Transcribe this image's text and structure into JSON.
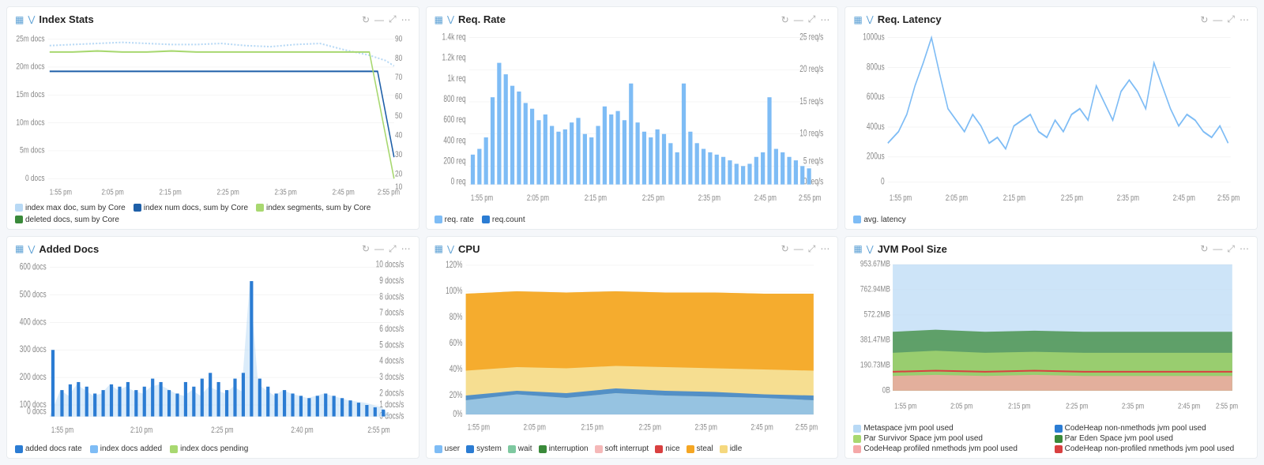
{
  "panels": {
    "index_stats": {
      "title": "Index Stats",
      "legend": [
        {
          "color": "#b8d9f5",
          "label": "index max doc, sum by Core"
        },
        {
          "color": "#1e5fa8",
          "label": "index num docs, sum by Core"
        },
        {
          "color": "#a8d870",
          "label": "index segments, sum by Core"
        },
        {
          "color": "#3a8a3a",
          "label": "deleted docs, sum by Core"
        }
      ],
      "y_labels_left": [
        "25m docs",
        "20m docs",
        "15m docs",
        "10m docs",
        "5m docs",
        "0 docs"
      ],
      "y_labels_right": [
        "90",
        "80",
        "70",
        "60",
        "50",
        "40",
        "30",
        "20",
        "10"
      ],
      "x_labels": [
        "1:55 pm",
        "2:05 pm",
        "2:15 pm",
        "2:25 pm",
        "2:35 pm",
        "2:45 pm",
        "2:55 pm"
      ]
    },
    "req_rate": {
      "title": "Req. Rate",
      "legend": [
        {
          "color": "#7ebcf5",
          "label": "req. rate"
        },
        {
          "color": "#2b7cd3",
          "label": "req.count"
        }
      ],
      "y_labels_left": [
        "1.4k req",
        "1.2k req",
        "1k req",
        "800 req",
        "600 req",
        "400 req",
        "200 req",
        "0 req"
      ],
      "y_labels_right": [
        "25 req/s",
        "20 req/s",
        "15 req/s",
        "10 req/s",
        "5 req/s",
        "0 req/s"
      ],
      "x_labels": [
        "1:55 pm",
        "2:05 pm",
        "2:15 pm",
        "2:25 pm",
        "2:35 pm",
        "2:45 pm",
        "2:55 pm"
      ]
    },
    "req_latency": {
      "title": "Req. Latency",
      "legend": [
        {
          "color": "#7ebcf5",
          "label": "avg. latency"
        }
      ],
      "y_labels_left": [
        "1000us",
        "800us",
        "600us",
        "400us",
        "200us",
        "0"
      ],
      "x_labels": [
        "1:55 pm",
        "2:05 pm",
        "2:15 pm",
        "2:25 pm",
        "2:35 pm",
        "2:45 pm",
        "2:55 pm"
      ]
    },
    "added_docs": {
      "title": "Added Docs",
      "legend": [
        {
          "color": "#2b7cd3",
          "label": "added docs rate"
        },
        {
          "color": "#7ebcf5",
          "label": "index docs added"
        },
        {
          "color": "#a8d870",
          "label": "index docs pending"
        }
      ],
      "y_labels_left": [
        "600 docs",
        "500 docs",
        "400 docs",
        "300 docs",
        "200 docs",
        "100 docs",
        "0 docs"
      ],
      "y_labels_right": [
        "10 docs/s",
        "9 docs/s",
        "8 docs/s",
        "7 docs/s",
        "6 docs/s",
        "5 docs/s",
        "4 docs/s",
        "3 docs/s",
        "2 docs/s",
        "1 docs/s",
        "0 docs/s"
      ],
      "x_labels": [
        "1:55 pm",
        "2:10 pm",
        "2:25 pm",
        "2:40 pm",
        "2:55 pm"
      ]
    },
    "cpu": {
      "title": "CPU",
      "legend": [
        {
          "color": "#7ebcf5",
          "label": "user"
        },
        {
          "color": "#2b7cd3",
          "label": "system"
        },
        {
          "color": "#7ec8a0",
          "label": "wait"
        },
        {
          "color": "#3a8a3a",
          "label": "interruption"
        },
        {
          "color": "#f5b8b8",
          "label": "soft interrupt"
        },
        {
          "color": "#d94040",
          "label": "nice"
        },
        {
          "color": "#f5a623",
          "label": "steal"
        },
        {
          "color": "#f5d87e",
          "label": "idle"
        }
      ],
      "y_labels": [
        "120%",
        "100%",
        "80%",
        "60%",
        "40%",
        "20%",
        "0%"
      ],
      "x_labels": [
        "1:55 pm",
        "2:05 pm",
        "2:15 pm",
        "2:25 pm",
        "2:35 pm",
        "2:45 pm",
        "2:55 pm"
      ]
    },
    "jvm_pool": {
      "title": "JVM Pool Size",
      "legend": [
        {
          "color": "#b8d9f5",
          "label": "Metaspace jvm pool used"
        },
        {
          "color": "#2b7cd3",
          "label": "CodeHeap non-nmethods jvm pool used"
        },
        {
          "color": "#a8d870",
          "label": "Par Survivor Space jvm pool used"
        },
        {
          "color": "#3a8a3a",
          "label": "Par Eden Space jvm pool used"
        },
        {
          "color": "#f5a8a8",
          "label": "CodeHeap profiled nmethods jvm pool used"
        },
        {
          "color": "#d94040",
          "label": "CodeHeap non-profiled nmethods jvm pool used"
        }
      ],
      "y_labels": [
        "953.67MB",
        "762.94MB",
        "572.2MB",
        "381.47MB",
        "190.73MB",
        "0B"
      ],
      "x_labels": [
        "1:55 pm",
        "2:05 pm",
        "2:15 pm",
        "2:25 pm",
        "2:35 pm",
        "2:45 pm",
        "2:55 pm"
      ]
    }
  },
  "icons": {
    "bar_chart": "▦",
    "filter": "⋁",
    "refresh": "↻",
    "minimize": "—",
    "expand": "⤢",
    "more": "⋯"
  }
}
